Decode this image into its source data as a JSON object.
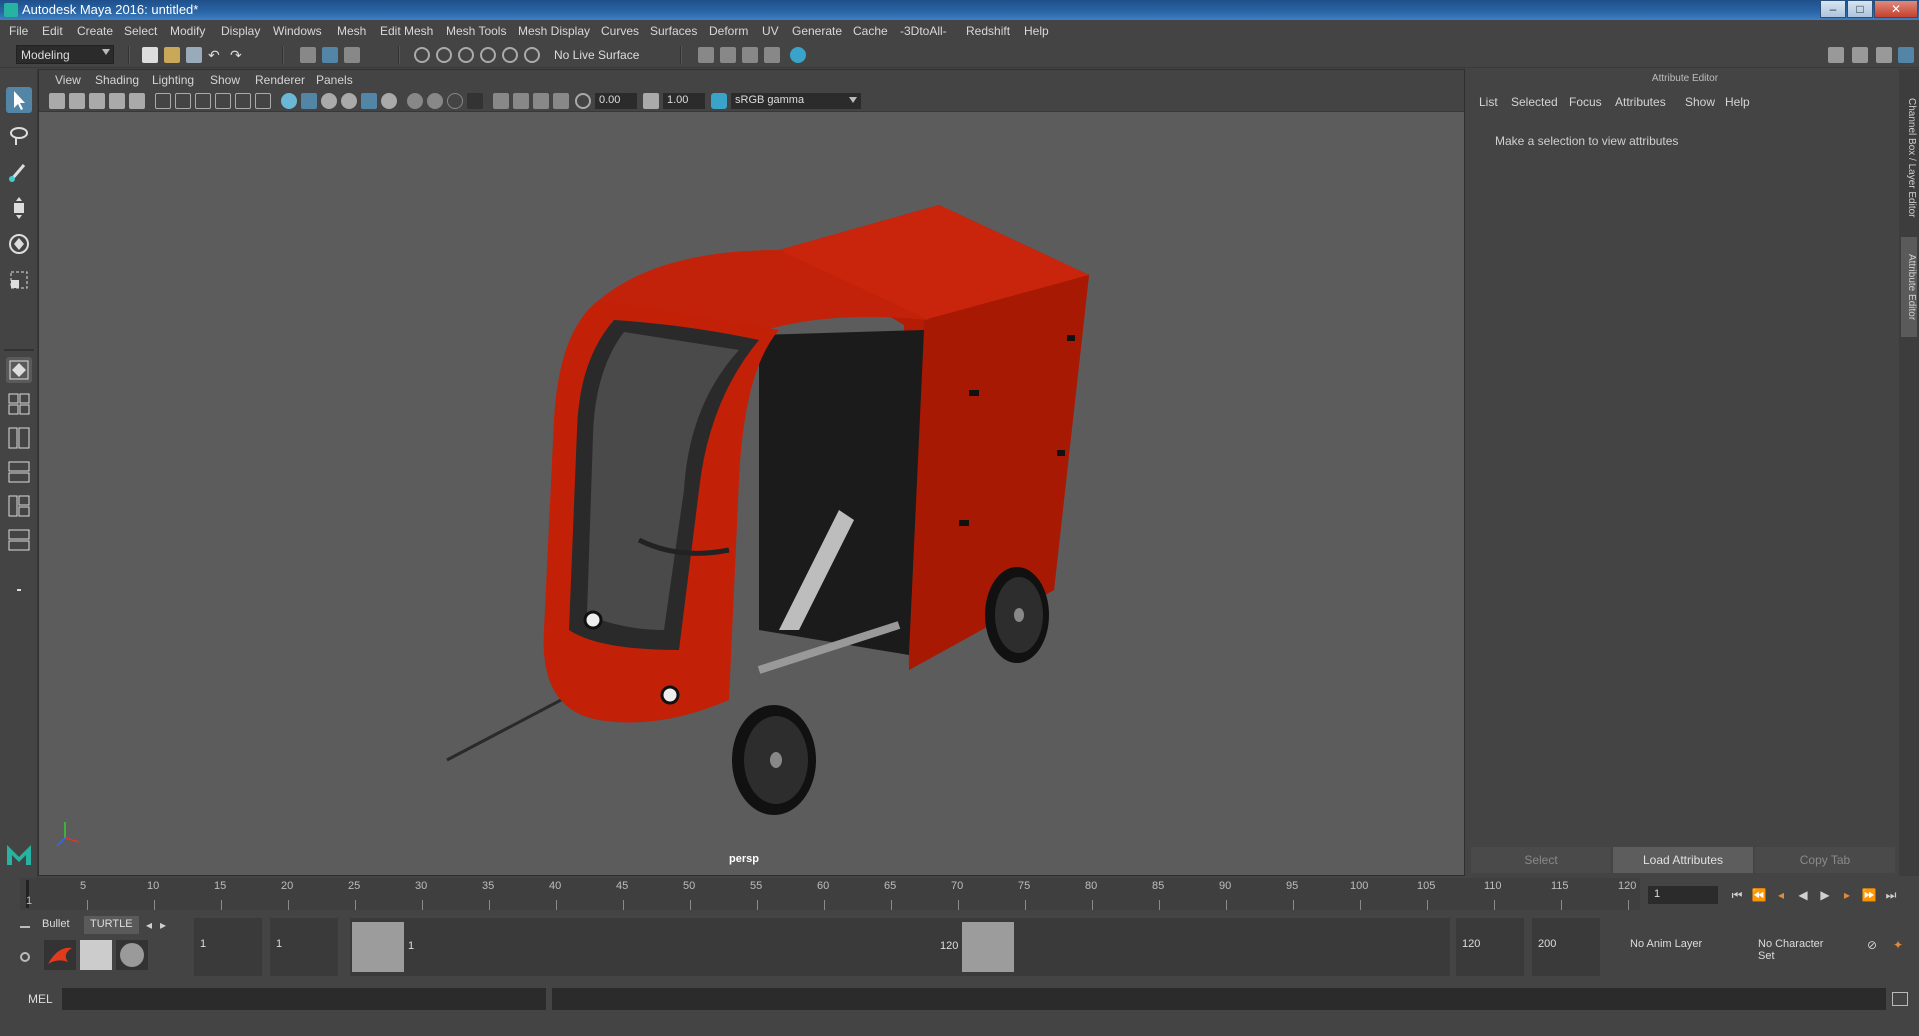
{
  "window": {
    "title": "Autodesk Maya 2016: untitled*",
    "buttons": {
      "minimize": "–",
      "maximize": "□",
      "close": "✕"
    }
  },
  "menubar": {
    "items": [
      "File",
      "Edit",
      "Create",
      "Select",
      "Modify",
      "Display",
      "Windows",
      "Mesh",
      "Edit Mesh",
      "Mesh Tools",
      "Mesh Display",
      "Curves",
      "Surfaces",
      "Deform",
      "UV",
      "Generate",
      "Cache",
      "-3DtoAll-",
      "Redshift",
      "Help"
    ]
  },
  "statusline": {
    "mode": "Modeling",
    "live_surface": "No Live Surface"
  },
  "viewport": {
    "menu": [
      "View",
      "Shading",
      "Lighting",
      "Show",
      "Renderer",
      "Panels"
    ],
    "exposure": "0.00",
    "gamma": "1.00",
    "color_space": "sRGB gamma",
    "camera": "persp"
  },
  "attribute_editor": {
    "header": "Attribute Editor",
    "menu": [
      "List",
      "Selected",
      "Focus",
      "Attributes",
      "Show",
      "Help"
    ],
    "message": "Make a selection to view attributes",
    "buttons": [
      "Select",
      "Load Attributes",
      "Copy Tab"
    ],
    "side_tabs": [
      "Channel Box / Layer Editor",
      "Attribute Editor"
    ]
  },
  "timeslider": {
    "tick_labels": [
      "1",
      "5",
      "10",
      "15",
      "20",
      "25",
      "30",
      "35",
      "40",
      "45",
      "50",
      "55",
      "60",
      "65",
      "70",
      "75",
      "80",
      "85",
      "90",
      "95",
      "100",
      "105",
      "110",
      "115",
      "120"
    ],
    "current_frame": "1"
  },
  "range": {
    "start": "1",
    "playback_start": "1",
    "handle_start": "1",
    "handle_end": "120",
    "playback_end": "120",
    "end": "200",
    "anim_layer": "No Anim Layer",
    "character_set": "No Character Set"
  },
  "shelf": {
    "tabs": [
      "Bullet",
      "TURTLE"
    ]
  },
  "cmdline": {
    "label": "MEL"
  },
  "colors": {
    "accent": "#5285a6",
    "vehicle": "#c01e08"
  }
}
